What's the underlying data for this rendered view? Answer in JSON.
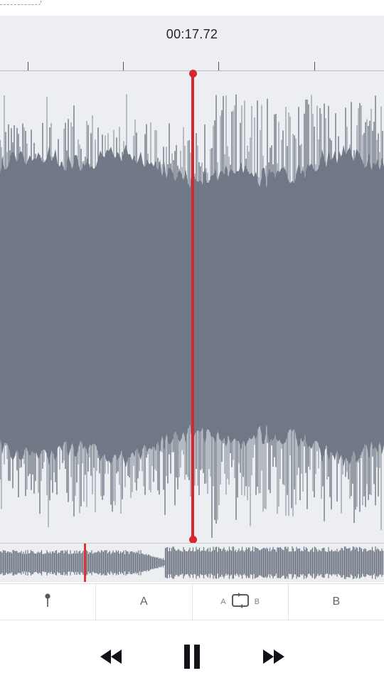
{
  "player": {
    "current_time": "00:17.72",
    "playhead_fraction": 0.5
  },
  "toolbar": {
    "marker_icon": "pin-icon",
    "a_label": "A",
    "loop_a_label": "A",
    "loop_b_label": "B",
    "loop_icon": "ab-loop-icon",
    "b_label": "B"
  },
  "transport": {
    "rewind_icon": "rewind-icon",
    "pause_icon": "pause-icon",
    "forward_icon": "fast-forward-icon"
  },
  "colors": {
    "waveform": "#717987",
    "waveform_mini": "#6e7683",
    "playhead": "#d7262e",
    "editor_background": "#eceef1",
    "toolbar_background": "#ffffff"
  }
}
